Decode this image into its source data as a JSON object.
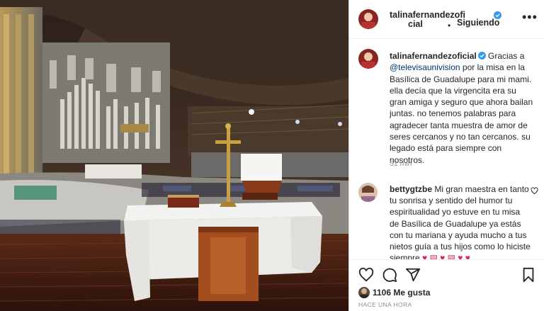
{
  "post": {
    "username_line1": "talinafernandezofi",
    "username_line2": "cial",
    "follow_label": "Siguiendo",
    "separator": "•",
    "more_label": "•••",
    "photo_icon": "basilica-photo"
  },
  "caption": {
    "username": "talinafernandezoficial",
    "text_before_mention": " Gracias a ",
    "mention": "@televisaunivision",
    "text_after_mention": " por la misa en la Basílica de Guadalupe para mi mami. ella decía que la virgencita era su gran amiga y seguro que ahora bailan juntas. no tenemos palabras para agradecer tanta muestra de amor de seres cercanos y no tan cercanos. su legado está para siempre con nosotros.",
    "time": "51 min"
  },
  "comment": {
    "username": "bettygtzbe",
    "text": " Mi gran maestra en tanto tu sonrisa y sentido del humor tu espiritualidad yo estuve en tu misa de Basílica de Guadalupe ya estás con tu mariana y ayuda mucho a tus nietos guía a tus hijos como lo hiciste siempre ",
    "emojis": "♥ ▤ ♥ ▤ ♥ ♥"
  },
  "actions": {
    "icons": [
      "heart-icon",
      "comment-icon",
      "share-icon",
      "bookmark-icon"
    ],
    "likes": "1106 Me gusta",
    "posted": "HACE UNA HORA"
  },
  "colors": {
    "verified": "#3897f0",
    "link": "#00376b",
    "muted": "#8e8e8e",
    "heart": "#e0244d"
  }
}
